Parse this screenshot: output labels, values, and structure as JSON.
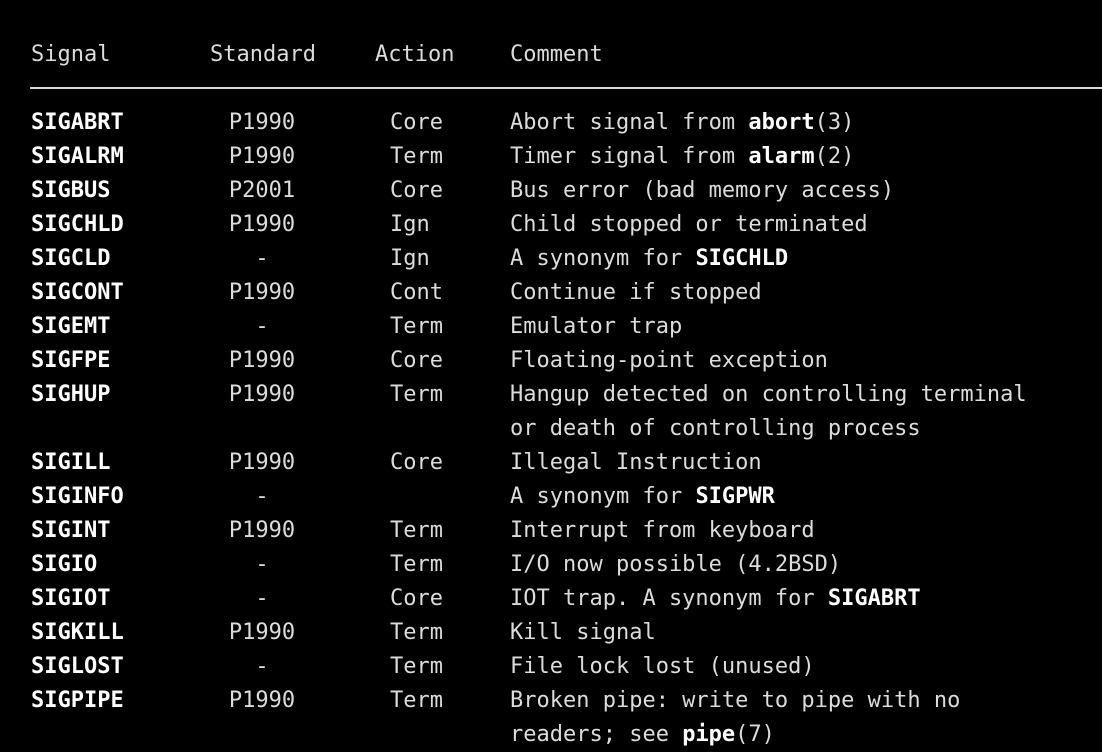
{
  "header": {
    "signal": "Signal",
    "standard": "Standard",
    "action": "Action",
    "comment": "Comment"
  },
  "rows": [
    {
      "signal": "SIGABRT",
      "standard": "P1990",
      "action": "Core",
      "comment": [
        [
          {
            "t": "Abort signal from "
          },
          {
            "t": "abort",
            "b": true
          },
          {
            "t": "(3)"
          }
        ]
      ]
    },
    {
      "signal": "SIGALRM",
      "standard": "P1990",
      "action": "Term",
      "comment": [
        [
          {
            "t": "Timer signal from "
          },
          {
            "t": "alarm",
            "b": true
          },
          {
            "t": "(2)"
          }
        ]
      ]
    },
    {
      "signal": "SIGBUS",
      "standard": "P2001",
      "action": "Core",
      "comment": [
        [
          {
            "t": "Bus error (bad memory access)"
          }
        ]
      ]
    },
    {
      "signal": "SIGCHLD",
      "standard": "P1990",
      "action": "Ign",
      "comment": [
        [
          {
            "t": "Child stopped or terminated"
          }
        ]
      ]
    },
    {
      "signal": "SIGCLD",
      "standard": "-",
      "action": "Ign",
      "comment": [
        [
          {
            "t": "A synonym for "
          },
          {
            "t": "SIGCHLD",
            "b": true
          }
        ]
      ]
    },
    {
      "signal": "SIGCONT",
      "standard": "P1990",
      "action": "Cont",
      "comment": [
        [
          {
            "t": "Continue if stopped"
          }
        ]
      ]
    },
    {
      "signal": "SIGEMT",
      "standard": "-",
      "action": "Term",
      "comment": [
        [
          {
            "t": "Emulator trap"
          }
        ]
      ]
    },
    {
      "signal": "SIGFPE",
      "standard": "P1990",
      "action": "Core",
      "comment": [
        [
          {
            "t": "Floating-point exception"
          }
        ]
      ]
    },
    {
      "signal": "SIGHUP",
      "standard": "P1990",
      "action": "Term",
      "comment": [
        [
          {
            "t": "Hangup detected on controlling terminal"
          }
        ],
        [
          {
            "t": "or death of controlling process"
          }
        ]
      ]
    },
    {
      "signal": "SIGILL",
      "standard": "P1990",
      "action": "Core",
      "comment": [
        [
          {
            "t": "Illegal Instruction"
          }
        ]
      ]
    },
    {
      "signal": "SIGINFO",
      "standard": "-",
      "action": "",
      "comment": [
        [
          {
            "t": "A synonym for "
          },
          {
            "t": "SIGPWR",
            "b": true
          }
        ]
      ]
    },
    {
      "signal": "SIGINT",
      "standard": "P1990",
      "action": "Term",
      "comment": [
        [
          {
            "t": "Interrupt from keyboard"
          }
        ]
      ]
    },
    {
      "signal": "SIGIO",
      "standard": "-",
      "action": "Term",
      "comment": [
        [
          {
            "t": "I/O now possible (4.2BSD)"
          }
        ]
      ]
    },
    {
      "signal": "SIGIOT",
      "standard": "-",
      "action": "Core",
      "comment": [
        [
          {
            "t": "IOT trap. A synonym for "
          },
          {
            "t": "SIGABRT",
            "b": true
          }
        ]
      ]
    },
    {
      "signal": "SIGKILL",
      "standard": "P1990",
      "action": "Term",
      "comment": [
        [
          {
            "t": "Kill signal"
          }
        ]
      ]
    },
    {
      "signal": "SIGLOST",
      "standard": "-",
      "action": "Term",
      "comment": [
        [
          {
            "t": "File lock lost (unused)"
          }
        ]
      ]
    },
    {
      "signal": "SIGPIPE",
      "standard": "P1990",
      "action": "Term",
      "comment": [
        [
          {
            "t": "Broken pipe: write to pipe with no"
          }
        ],
        [
          {
            "t": "readers; see "
          },
          {
            "t": "pipe",
            "b": true
          },
          {
            "t": "(7)"
          }
        ]
      ]
    }
  ]
}
